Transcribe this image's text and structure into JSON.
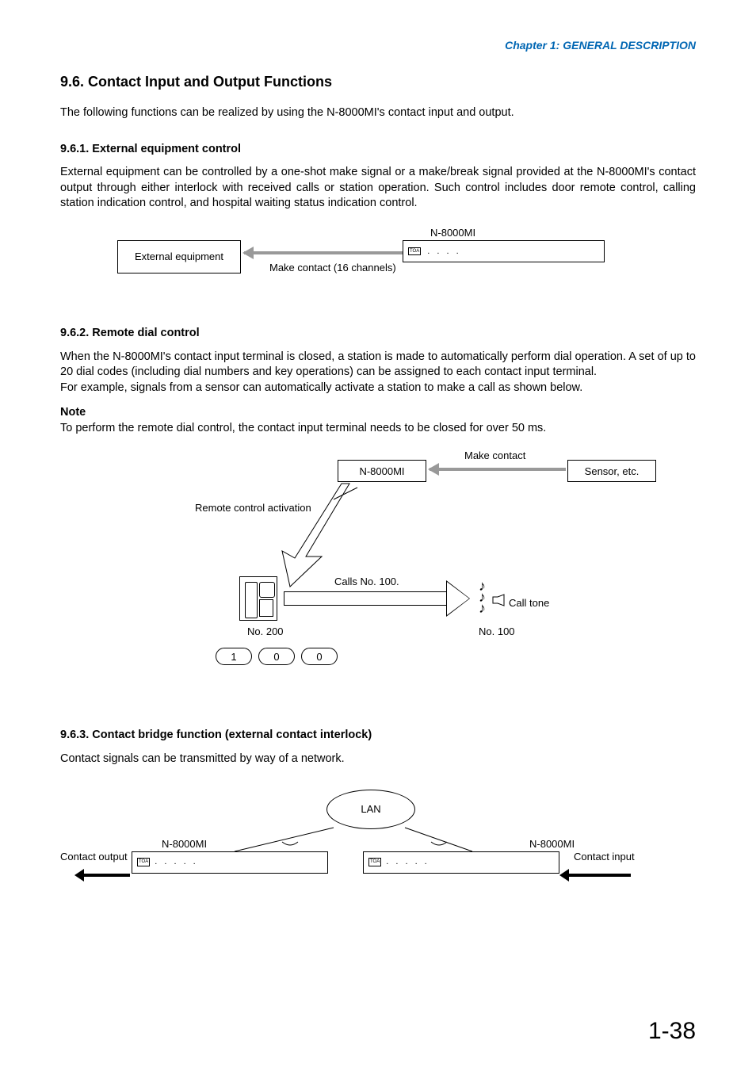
{
  "chapter_header": "Chapter 1:  GENERAL DESCRIPTION",
  "section_title": "9.6. Contact Input and Output Functions",
  "intro": "The following functions can be realized by using the N-8000MI's contact input and output.",
  "s961": {
    "title": "9.6.1. External equipment control",
    "body": "External equipment can be controlled by a one-shot make signal or a make/break signal provided at the N-8000MI's contact output through either interlock with received calls or station operation. Such control includes door remote control, calling station indication control, and hospital waiting status indication control.",
    "diag": {
      "ext_box": "External equipment",
      "arrow_caption": "Make contact (16 channels)",
      "device_label": "N-8000MI",
      "device_brand": "TOA",
      "device_dots": ". . . ."
    }
  },
  "s962": {
    "title": "9.6.2. Remote dial control",
    "body1": "When the N-8000MI's contact input terminal is closed, a station is made to automatically perform dial operation. A set of up to 20 dial codes (including dial numbers and key operations) can be assigned to each contact input terminal.",
    "body2": "For example, signals from a sensor can automatically activate a station to make a call as shown below.",
    "note_label": "Note",
    "note_body": "To perform the remote dial control, the contact input terminal needs to be closed for over 50 ms.",
    "diag": {
      "mi_box": "N-8000MI",
      "sensor_box": "Sensor, etc.",
      "make_contact": "Make contact",
      "rca": "Remote control activation",
      "calls_label": "Calls No. 100.",
      "station_no_200": "No. 200",
      "station_no_100": "No. 100",
      "call_tone": "Call tone",
      "dial": [
        "1",
        "0",
        "0"
      ]
    }
  },
  "s963": {
    "title": "9.6.3. Contact bridge function (external contact interlock)",
    "body": "Contact signals can be transmitted by way of a network.",
    "diag": {
      "lan": "LAN",
      "device_label_left": "N-8000MI",
      "device_label_right": "N-8000MI",
      "contact_output": "Contact output",
      "contact_input": "Contact input",
      "device_brand": "TOA",
      "device_dots": ". . . . ."
    }
  },
  "page_number": "1-38"
}
